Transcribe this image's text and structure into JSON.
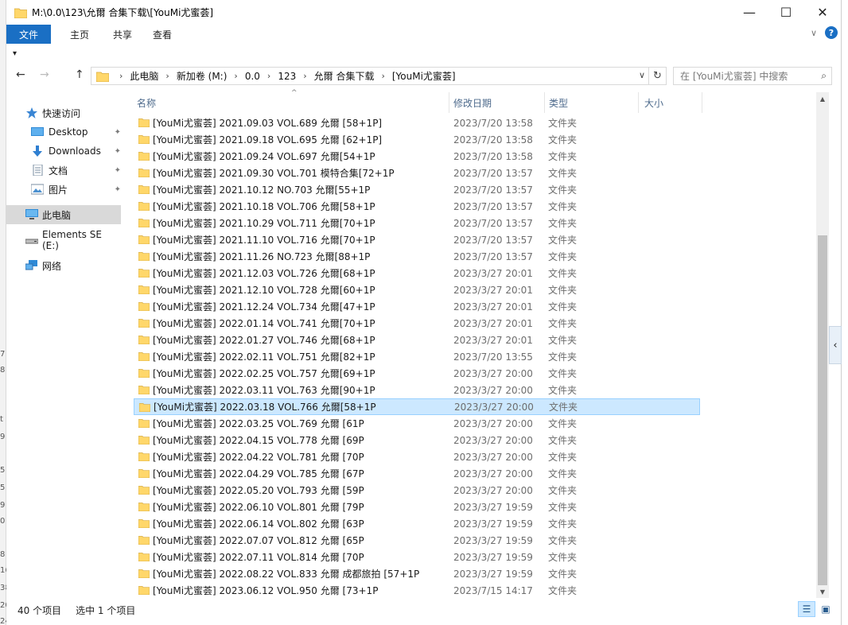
{
  "window": {
    "title": "M:\\0.0\\123\\允爾 合集下载\\[YouMi尤蜜荟]",
    "minimize": "—",
    "maximize": "☐",
    "close": "✕"
  },
  "ribbon": {
    "tabs": [
      "文件",
      "主页",
      "共享",
      "查看"
    ],
    "expand": "∨",
    "help": "?"
  },
  "qat": {
    "dropdown": "▾"
  },
  "nav_buttons": {
    "back": "←",
    "forward": "→",
    "up": "↑"
  },
  "address": {
    "crumbs": [
      "此电脑",
      "新加卷 (M:)",
      "0.0",
      "123",
      "允爾 合集下载",
      "[YouMi尤蜜荟]"
    ],
    "separator": "›",
    "dropdown": "∨",
    "refresh": "↻"
  },
  "search": {
    "placeholder": "在 [YouMi尤蜜荟] 中搜索",
    "icon": "⌕"
  },
  "navpane": {
    "items": [
      {
        "label": "快速访问",
        "icon": "star-icon"
      },
      {
        "label": "Desktop",
        "icon": "desktop-icon",
        "pinned": true
      },
      {
        "label": "Downloads",
        "icon": "download-icon",
        "pinned": true
      },
      {
        "label": "文档",
        "icon": "document-icon",
        "pinned": true
      },
      {
        "label": "图片",
        "icon": "pictures-icon",
        "pinned": true
      },
      {
        "label": "此电脑",
        "icon": "computer-icon",
        "selected": true
      },
      {
        "label": "Elements SE (E:)",
        "icon": "drive-icon"
      },
      {
        "label": "网络",
        "icon": "network-icon"
      }
    ],
    "pin_glyph": "📌"
  },
  "columns": {
    "name": "名称",
    "date": "修改日期",
    "type": "类型",
    "size": "大小",
    "sort_arrow": "^"
  },
  "files": [
    {
      "name": "[YouMi尤蜜荟] 2021.09.03 VOL.689 允爾 [58+1P]",
      "date": "2023/7/20 13:58",
      "type": "文件夹"
    },
    {
      "name": "[YouMi尤蜜荟] 2021.09.18 VOL.695 允爾 [62+1P]",
      "date": "2023/7/20 13:58",
      "type": "文件夹"
    },
    {
      "name": "[YouMi尤蜜荟] 2021.09.24 VOL.697 允爾[54+1P",
      "date": "2023/7/20 13:58",
      "type": "文件夹"
    },
    {
      "name": "[YouMi尤蜜荟] 2021.09.30 VOL.701 模特合集[72+1P",
      "date": "2023/7/20 13:57",
      "type": "文件夹"
    },
    {
      "name": "[YouMi尤蜜荟] 2021.10.12 NO.703 允爾[55+1P",
      "date": "2023/7/20 13:57",
      "type": "文件夹"
    },
    {
      "name": "[YouMi尤蜜荟] 2021.10.18 VOL.706 允爾[58+1P",
      "date": "2023/7/20 13:57",
      "type": "文件夹"
    },
    {
      "name": "[YouMi尤蜜荟] 2021.10.29 VOL.711 允爾[70+1P",
      "date": "2023/7/20 13:57",
      "type": "文件夹"
    },
    {
      "name": "[YouMi尤蜜荟] 2021.11.10 VOL.716 允爾[70+1P",
      "date": "2023/7/20 13:57",
      "type": "文件夹"
    },
    {
      "name": "[YouMi尤蜜荟] 2021.11.26 NO.723 允爾[88+1P",
      "date": "2023/7/20 13:57",
      "type": "文件夹"
    },
    {
      "name": "[YouMi尤蜜荟] 2021.12.03 VOL.726 允爾[68+1P",
      "date": "2023/3/27 20:01",
      "type": "文件夹"
    },
    {
      "name": "[YouMi尤蜜荟] 2021.12.10 VOL.728 允爾[60+1P",
      "date": "2023/3/27 20:01",
      "type": "文件夹"
    },
    {
      "name": "[YouMi尤蜜荟] 2021.12.24 VOL.734 允爾[47+1P",
      "date": "2023/3/27 20:01",
      "type": "文件夹"
    },
    {
      "name": "[YouMi尤蜜荟] 2022.01.14 VOL.741 允爾[70+1P",
      "date": "2023/3/27 20:01",
      "type": "文件夹"
    },
    {
      "name": "[YouMi尤蜜荟] 2022.01.27 VOL.746 允爾[68+1P",
      "date": "2023/3/27 20:01",
      "type": "文件夹"
    },
    {
      "name": "[YouMi尤蜜荟] 2022.02.11 VOL.751 允爾[82+1P",
      "date": "2023/7/20 13:55",
      "type": "文件夹"
    },
    {
      "name": "[YouMi尤蜜荟] 2022.02.25 VOL.757 允爾[69+1P",
      "date": "2023/3/27 20:00",
      "type": "文件夹"
    },
    {
      "name": "[YouMi尤蜜荟] 2022.03.11 VOL.763 允爾[90+1P",
      "date": "2023/3/27 20:00",
      "type": "文件夹"
    },
    {
      "name": "[YouMi尤蜜荟] 2022.03.18 VOL.766 允爾[58+1P",
      "date": "2023/3/27 20:00",
      "type": "文件夹",
      "selected": true
    },
    {
      "name": "[YouMi尤蜜荟] 2022.03.25 VOL.769 允爾 [61P",
      "date": "2023/3/27 20:00",
      "type": "文件夹"
    },
    {
      "name": "[YouMi尤蜜荟] 2022.04.15 VOL.778 允爾 [69P",
      "date": "2023/3/27 20:00",
      "type": "文件夹"
    },
    {
      "name": "[YouMi尤蜜荟] 2022.04.22 VOL.781 允爾 [70P",
      "date": "2023/3/27 20:00",
      "type": "文件夹"
    },
    {
      "name": "[YouMi尤蜜荟] 2022.04.29 VOL.785 允爾 [67P",
      "date": "2023/3/27 20:00",
      "type": "文件夹"
    },
    {
      "name": "[YouMi尤蜜荟] 2022.05.20 VOL.793 允爾 [59P",
      "date": "2023/3/27 20:00",
      "type": "文件夹"
    },
    {
      "name": "[YouMi尤蜜荟] 2022.06.10 VOL.801 允爾 [79P",
      "date": "2023/3/27 19:59",
      "type": "文件夹"
    },
    {
      "name": "[YouMi尤蜜荟] 2022.06.14 VOL.802 允爾 [63P",
      "date": "2023/3/27 19:59",
      "type": "文件夹"
    },
    {
      "name": "[YouMi尤蜜荟] 2022.07.07 VOL.812 允爾 [65P",
      "date": "2023/3/27 19:59",
      "type": "文件夹"
    },
    {
      "name": "[YouMi尤蜜荟] 2022.07.11 VOL.814 允爾 [70P",
      "date": "2023/3/27 19:59",
      "type": "文件夹"
    },
    {
      "name": "[YouMi尤蜜荟] 2022.08.22 VOL.833 允爾 成都旅拍 [57+1P",
      "date": "2023/3/27 19:59",
      "type": "文件夹"
    },
    {
      "name": "[YouMi尤蜜荟] 2023.06.12 VOL.950 允爾 [73+1P",
      "date": "2023/7/15 14:17",
      "type": "文件夹"
    }
  ],
  "scrollbar": {
    "up": "▲",
    "down": "▼"
  },
  "side_handle": "‹",
  "status": {
    "item_count": "40 个项目",
    "selected": "选中 1 个项目"
  },
  "view_buttons": {
    "details": "☰",
    "large_icons": "▣"
  },
  "left_edge_digits": [
    "7",
    "8",
    "t",
    "9",
    "5",
    "5",
    "9",
    "0",
    "16",
    "8",
    "38",
    "20",
    "24"
  ],
  "colors": {
    "accent": "#1a6fc4",
    "selection": "#cce8ff",
    "selection_border": "#99d1ff",
    "folder": "#ffd76a"
  }
}
